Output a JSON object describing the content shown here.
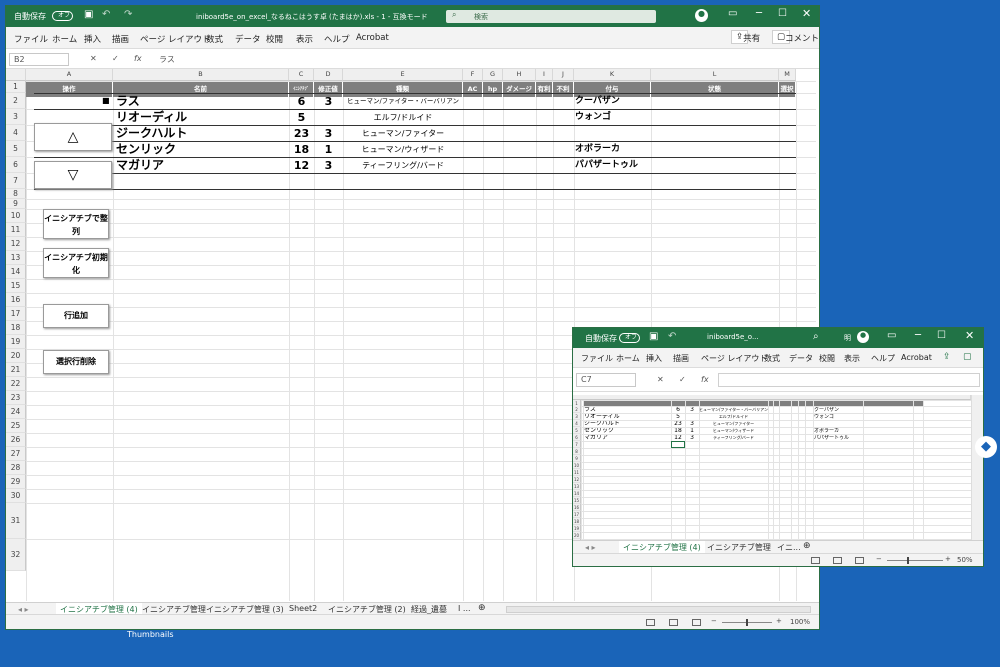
{
  "desktop": {
    "label": "Thumbnails"
  },
  "w1": {
    "autosave": "自動保存",
    "toggle": "オフ",
    "title": "iniboard5e_on_excel_なるねこはうす卓 (たまはか).xls - 1 - 互換モード",
    "search": "検索",
    "menu": [
      "ファイル",
      "ホーム",
      "挿入",
      "描画",
      "ページ レイアウト",
      "数式",
      "データ",
      "校閲",
      "表示",
      "ヘルプ",
      "Acrobat"
    ],
    "share": "共有",
    "comment": "コメント",
    "namebox": "B2",
    "formula": "ラス",
    "cols": [
      "A",
      "B",
      "C",
      "D",
      "E",
      "F",
      "G",
      "H",
      "I",
      "J",
      "K",
      "L",
      "M"
    ],
    "headers": [
      "操作",
      "名前",
      "ｲﾆｼｱﾁﾌﾞ",
      "修正値",
      "種類",
      "AC",
      "hp",
      "ダメージ",
      "有利",
      "不利",
      "付与",
      "状態",
      "選択"
    ],
    "rows": [
      {
        "name": "ラス",
        "ini": "6",
        "mod": "3",
        "kind": "ヒューマン/ファイター・バーバリアン",
        "fuyo": "クーパザン"
      },
      {
        "name": "リオーディル",
        "ini": "5",
        "mod": "",
        "kind": "エルフ/ドルイド",
        "fuyo": "ウォンゴ"
      },
      {
        "name": "ジークハルト",
        "ini": "23",
        "mod": "3",
        "kind": "ヒューマン/ファイター",
        "fuyo": ""
      },
      {
        "name": "センリック",
        "ini": "18",
        "mod": "1",
        "kind": "ヒューマン/ウィザード",
        "fuyo": "オボラーカ"
      },
      {
        "name": "マガリア",
        "ini": "12",
        "mod": "3",
        "kind": "ティーフリング/バード",
        "fuyo": "パパザートゥル"
      }
    ],
    "rownums": [
      "1",
      "2",
      "3",
      "4",
      "5",
      "6",
      "7",
      "8",
      "9",
      "10",
      "11",
      "12",
      "13",
      "14",
      "15",
      "16",
      "17",
      "18",
      "19",
      "20",
      "21",
      "22",
      "23",
      "24",
      "25",
      "26",
      "27",
      "28",
      "29",
      "30",
      "31",
      "32"
    ],
    "marker": "■",
    "buttons": {
      "up": "△",
      "down": "▽",
      "sort": "イニシアチブで整列",
      "reset": "イニシアチブ初期化",
      "add": "行追加",
      "del": "選択行削除"
    },
    "tabs": [
      "イニシアチブ管理 (4)",
      "イニシアチブ管理",
      "イニシアチブ管理 (3)",
      "Sheet2",
      "イニシアチブ管理 (2)",
      "経過_遺墓",
      "I ..."
    ],
    "zoom": "100%"
  },
  "w2": {
    "autosave": "自動保存",
    "toggle": "オフ",
    "title": "iniboard5e_o...",
    "user": "明",
    "menu": [
      "ファイル",
      "ホーム",
      "挿入",
      "描画",
      "ページ レイアウト",
      "数式",
      "データ",
      "校閲",
      "表示",
      "ヘルプ",
      "Acrobat"
    ],
    "namebox": "C7",
    "tabs": [
      "イニシアチブ管理 (4)",
      "イニシアチブ管理",
      "イニ..."
    ],
    "zoom": "50%"
  }
}
